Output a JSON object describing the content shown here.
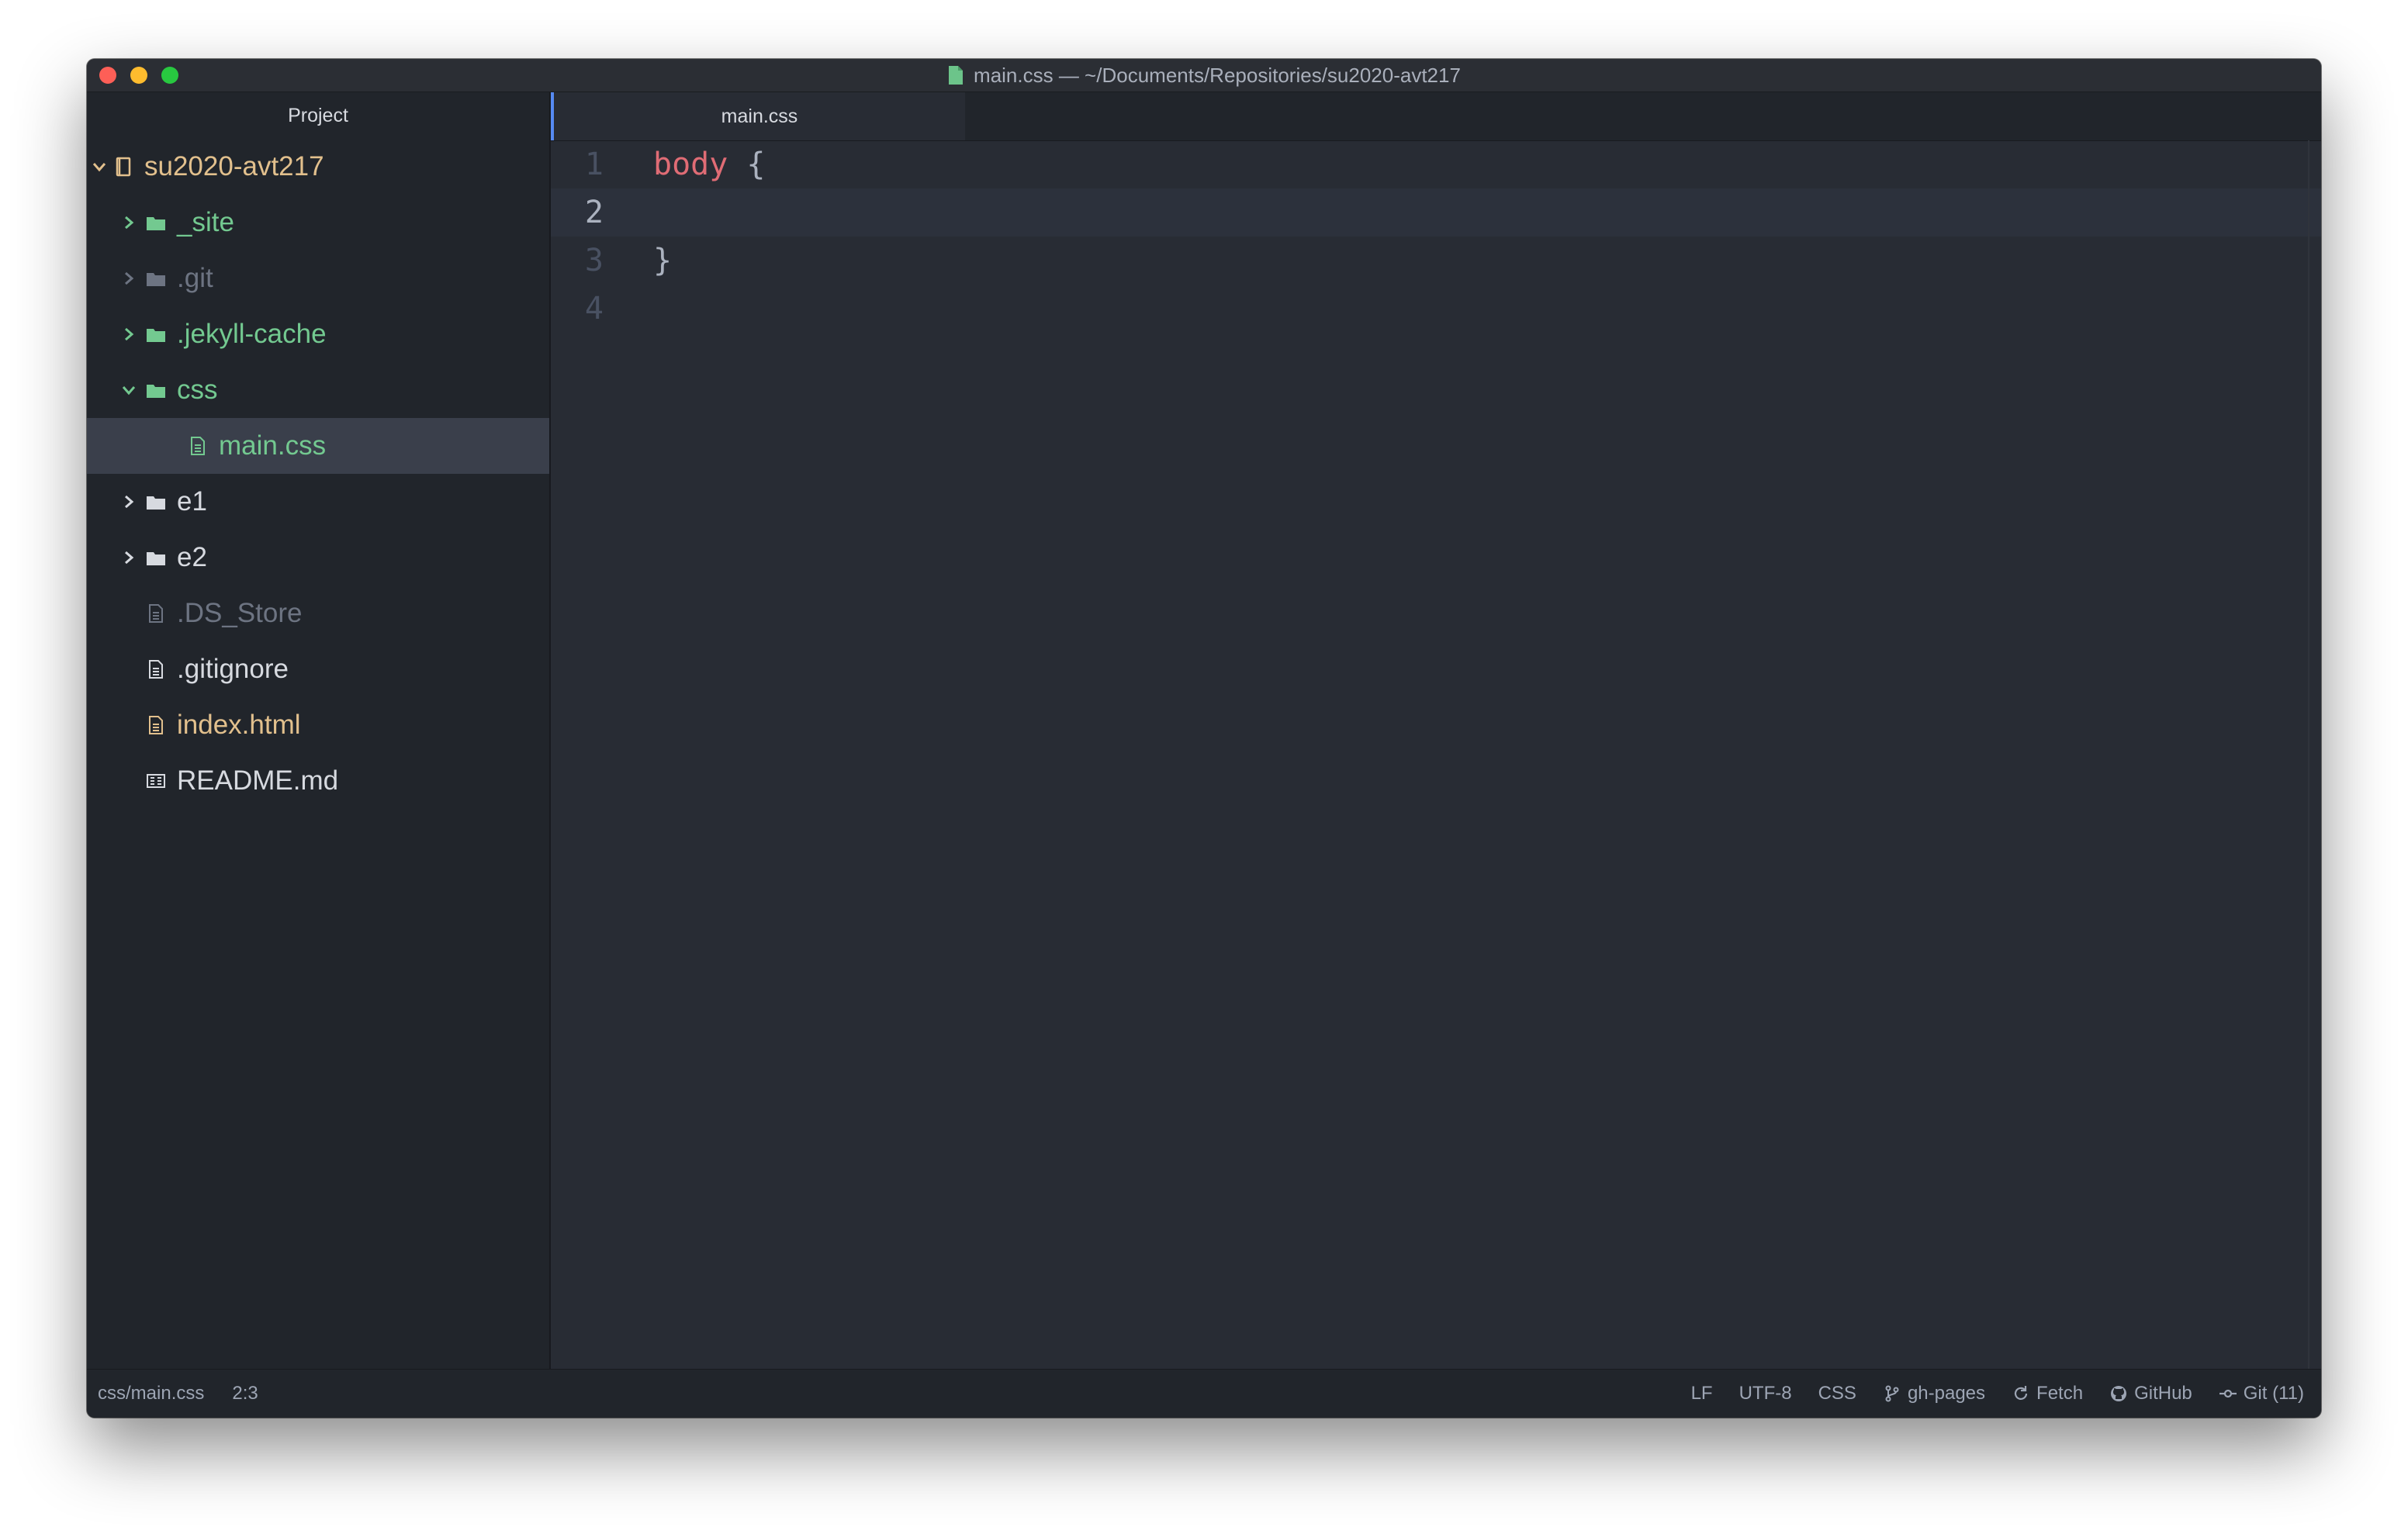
{
  "window": {
    "title": "main.css — ~/Documents/Repositories/su2020-avt217"
  },
  "sidebar": {
    "header": "Project",
    "root": {
      "label": "su2020-avt217",
      "icon": "repo-icon",
      "expanded": true
    },
    "items": [
      {
        "label": "_site",
        "type": "folder",
        "expanded": false,
        "status": "added"
      },
      {
        "label": ".git",
        "type": "folder",
        "expanded": false,
        "status": "ignored"
      },
      {
        "label": ".jekyll-cache",
        "type": "folder",
        "expanded": false,
        "status": "added"
      },
      {
        "label": "css",
        "type": "folder",
        "expanded": true,
        "status": "added"
      },
      {
        "label": "main.css",
        "type": "file",
        "status": "added",
        "selected": true
      },
      {
        "label": "e1",
        "type": "folder",
        "expanded": false,
        "status": "normal"
      },
      {
        "label": "e2",
        "type": "folder",
        "expanded": false,
        "status": "normal"
      },
      {
        "label": ".DS_Store",
        "type": "file",
        "status": "ignored"
      },
      {
        "label": ".gitignore",
        "type": "file",
        "status": "normal"
      },
      {
        "label": "index.html",
        "type": "file",
        "status": "modified"
      },
      {
        "label": "README.md",
        "type": "markdown",
        "status": "normal"
      }
    ]
  },
  "tabs": [
    {
      "label": "main.css",
      "active": true
    }
  ],
  "editor": {
    "lines": [
      {
        "number": "1",
        "selector": "body",
        "rest": " {"
      },
      {
        "number": "2",
        "selector": "",
        "rest": ""
      },
      {
        "number": "3",
        "selector": "",
        "rest": "}"
      },
      {
        "number": "4",
        "selector": "",
        "rest": ""
      }
    ],
    "current_line": 2
  },
  "statusbar": {
    "file_path": "css/main.css",
    "cursor": "2:3",
    "line_ending": "LF",
    "encoding": "UTF-8",
    "grammar": "CSS",
    "branch": "gh-pages",
    "fetch": "Fetch",
    "github": "GitHub",
    "git": "Git (11)"
  },
  "colors": {
    "added": "#73c990",
    "ignored": "#6d7482",
    "modified": "#e2c08d",
    "normal": "#d7dae0",
    "accent": "#568af2",
    "selector": "#e06c75"
  }
}
